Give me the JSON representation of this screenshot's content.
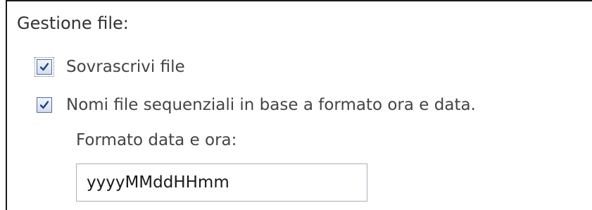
{
  "file_management": {
    "title": "Gestione file:",
    "overwrite": {
      "label": "Sovrascrivi file",
      "checked": true,
      "focused": true
    },
    "sequential": {
      "label": "Nomi file sequenziali in base a formato ora e data.",
      "checked": true
    },
    "date_format": {
      "label": "Formato data e ora:",
      "value": "yyyyMMddHHmm"
    }
  },
  "colors": {
    "text": "#333333",
    "checkbox_border": "#4f6f9a",
    "check_mark": "#1f3f86",
    "input_border": "#a9b0b8"
  },
  "icons": {
    "check": "check-icon"
  }
}
